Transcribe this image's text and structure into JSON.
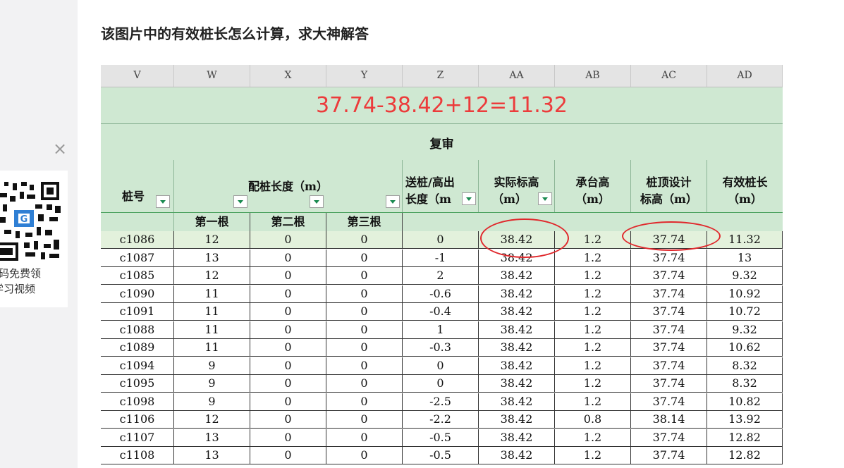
{
  "post": {
    "title": "该图片中的有效桩长怎么计算，求大神解答"
  },
  "qr_promo": {
    "line1": "码免费领",
    "line2": "学习视频",
    "close": "×"
  },
  "sheet": {
    "columns": [
      "V",
      "W",
      "X",
      "Y",
      "Z",
      "AA",
      "AB",
      "AC",
      "AD"
    ],
    "formula": "37.74-38.42+12=11.32",
    "review": "复审",
    "headers": {
      "pile_no": "桩号",
      "pile_length_a": "配桩长度（m）",
      "send_pile_a": "送桩/高出",
      "send_pile_b": "长度（m",
      "actual_elev_a": "实际标高",
      "actual_elev_b": "（m）",
      "cap_height_a": "承台高",
      "cap_height_b": "（m）",
      "design_elev_a": "桩顶设计",
      "design_elev_b": "标高（m）",
      "eff_len_a": "有效桩长",
      "eff_len_b": "（m）"
    },
    "subheaders": [
      "第一根",
      "第二根",
      "第三根"
    ],
    "rows": [
      [
        "c1086",
        "12",
        "0",
        "0",
        "0",
        "38.42",
        "1.2",
        "37.74",
        "11.32"
      ],
      [
        "c1087",
        "13",
        "0",
        "0",
        "-1",
        "38.42",
        "1.2",
        "37.74",
        "13"
      ],
      [
        "c1085",
        "12",
        "0",
        "0",
        "2",
        "38.42",
        "1.2",
        "37.74",
        "9.32"
      ],
      [
        "c1090",
        "11",
        "0",
        "0",
        "-0.6",
        "38.42",
        "1.2",
        "37.74",
        "10.92"
      ],
      [
        "c1091",
        "11",
        "0",
        "0",
        "-0.4",
        "38.42",
        "1.2",
        "37.74",
        "10.72"
      ],
      [
        "c1088",
        "11",
        "0",
        "0",
        "1",
        "38.42",
        "1.2",
        "37.74",
        "9.32"
      ],
      [
        "c1089",
        "11",
        "0",
        "0",
        "-0.3",
        "38.42",
        "1.2",
        "37.74",
        "10.62"
      ],
      [
        "c1094",
        "9",
        "0",
        "0",
        "0",
        "38.42",
        "1.2",
        "37.74",
        "8.32"
      ],
      [
        "c1095",
        "9",
        "0",
        "0",
        "0",
        "38.42",
        "1.2",
        "37.74",
        "8.32"
      ],
      [
        "c1098",
        "9",
        "0",
        "0",
        "-2.5",
        "38.42",
        "1.2",
        "37.74",
        "10.82"
      ],
      [
        "c1106",
        "12",
        "0",
        "0",
        "-2.2",
        "38.42",
        "0.8",
        "38.14",
        "13.92"
      ],
      [
        "c1107",
        "13",
        "0",
        "0",
        "-0.5",
        "38.42",
        "1.2",
        "37.74",
        "12.82"
      ],
      [
        "c1108",
        "13",
        "0",
        "0",
        "-0.5",
        "38.42",
        "1.2",
        "37.74",
        "12.82"
      ]
    ],
    "colors": {
      "band": "#cfe8d2",
      "highlight_row": "#e3f1dc",
      "annotation": "#e0282c"
    }
  }
}
